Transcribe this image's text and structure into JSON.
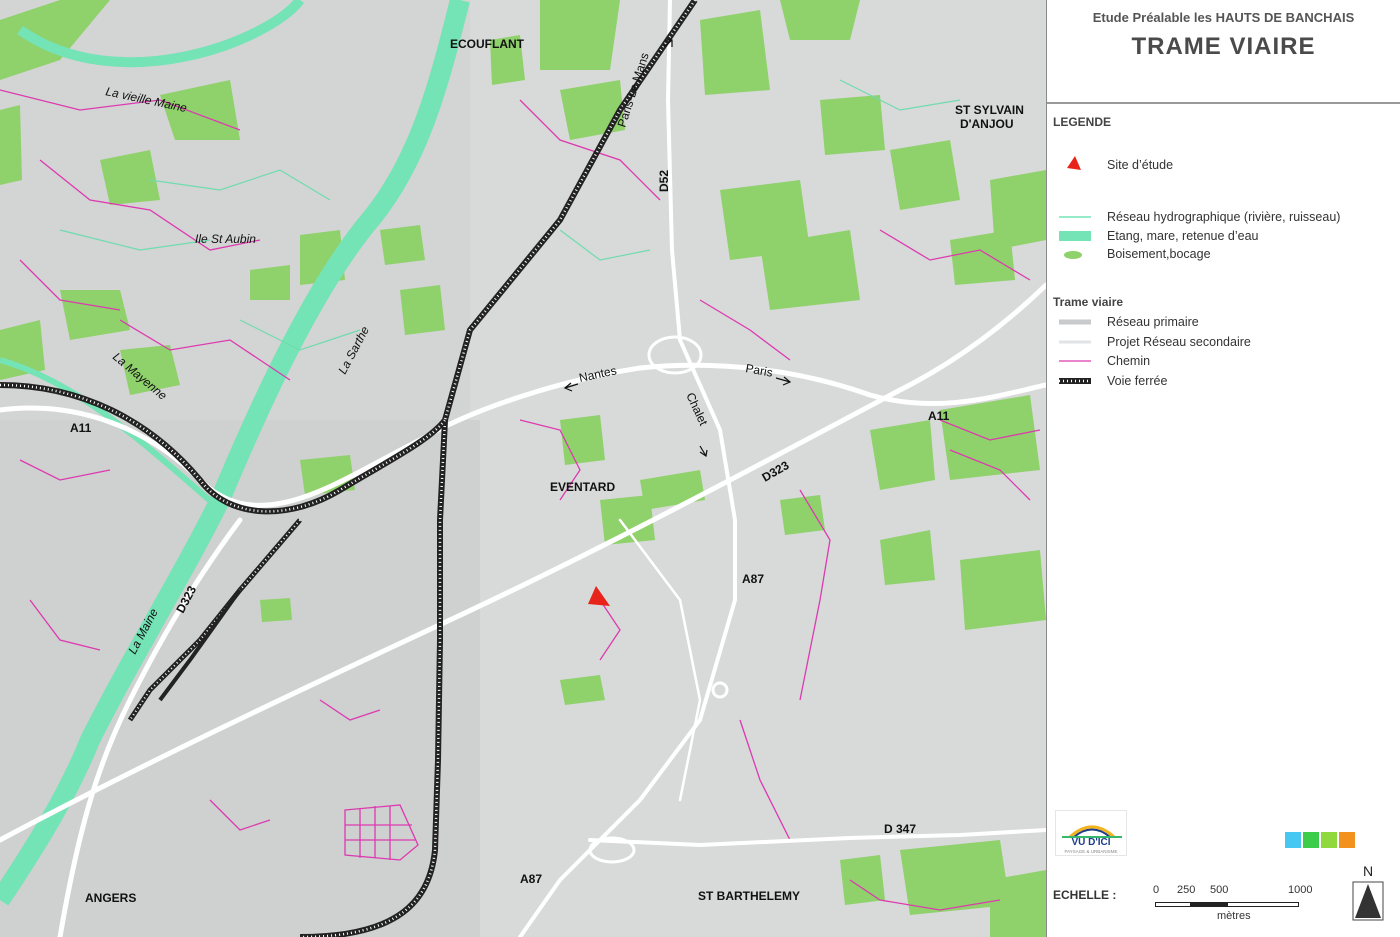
{
  "header": {
    "subtitle": "Etude Préalable les HAUTS DE BANCHAIS",
    "title": "TRAME VIAIRE"
  },
  "legend": {
    "heading": "LEGENDE",
    "site": "Site d’étude",
    "hydro": "Réseau hydrographique (rivière, ruisseau)",
    "etang": "Etang, mare, retenue d’eau",
    "boisement": "Boisement,bocage",
    "trame_heading": "Trame viaire",
    "reseau_primaire": "Réseau primaire",
    "projet_secondaire": "Projet Réseau secondaire",
    "chemin": "Chemin",
    "voie_ferree": "Voie ferrée"
  },
  "logo": {
    "name": "VU D'ICI",
    "tagline": "PAYSAGE & URBANISME"
  },
  "scale": {
    "label": "ECHELLE :",
    "ticks": [
      "0",
      "250",
      "500",
      "1000"
    ],
    "units": "mètres"
  },
  "north": {
    "label": "N"
  },
  "colors": {
    "green": "#8fd16b",
    "water": "#74e3b6",
    "path": "#dd3ab0",
    "site": "#e8231c",
    "road": "#ffffff"
  },
  "swatch_colors": [
    "#46c8f2",
    "#3ccd4b",
    "#8fd93f",
    "#f3911e"
  ],
  "map_labels": {
    "ecouflant": "ECOUFLANT",
    "st_sylvain": "ST SYLVAIN",
    "d_anjou": "D'ANJOU",
    "vieille_maine": "La vieille Maine",
    "ile_st_aubin": "Ile St Aubin",
    "sarthe": "La Sarthe",
    "mayenne": "La Mayenne",
    "paris_le_mans": "Paris-Le Mans",
    "d52": "D52",
    "nantes": "Nantes",
    "paris": "Paris",
    "chalet": "Chalet",
    "a11_left": "A11",
    "a11_right": "A11",
    "d323_right": "D323",
    "eventard": "EVENTARD",
    "a87_mid": "A87",
    "la_maine": "La Maine",
    "d323_left": "D323",
    "d347": "D 347",
    "a87_bottom": "A87",
    "angers": "ANGERS",
    "st_barthelemy": "ST BARTHELEMY"
  }
}
